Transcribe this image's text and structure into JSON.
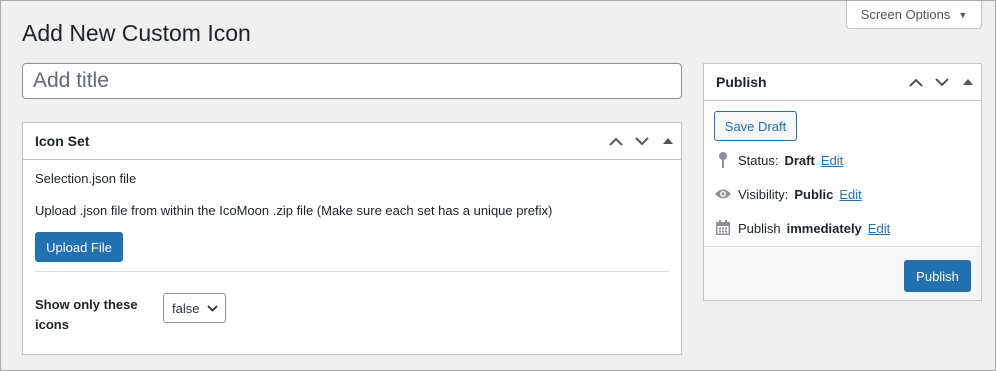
{
  "screen_options": {
    "label": "Screen Options"
  },
  "page": {
    "title": "Add New Custom Icon"
  },
  "title_input": {
    "placeholder": "Add title",
    "value": ""
  },
  "icon_set": {
    "title": "Icon Set",
    "file_label": "Selection.json file",
    "description": "Upload .json file from within the IcoMoon .zip file (Make sure each set has a unique prefix)",
    "upload_button": "Upload File",
    "show_only_label": "Show only these icons",
    "show_only_value": "false"
  },
  "publish": {
    "title": "Publish",
    "save_draft": "Save Draft",
    "status_label": "Status:",
    "status_value": "Draft",
    "visibility_label": "Visibility:",
    "visibility_value": "Public",
    "publish_label": "Publish",
    "publish_value": "immediately",
    "edit_link": "Edit",
    "publish_button": "Publish"
  },
  "colors": {
    "primary": "#2271b1",
    "background": "#f0f0f1",
    "panel_border": "#c3c4c7"
  },
  "icons": [
    "caret-down-icon",
    "chevron-up-icon",
    "chevron-down-icon",
    "triangle-up-icon",
    "pin-icon",
    "eye-icon",
    "calendar-icon"
  ]
}
